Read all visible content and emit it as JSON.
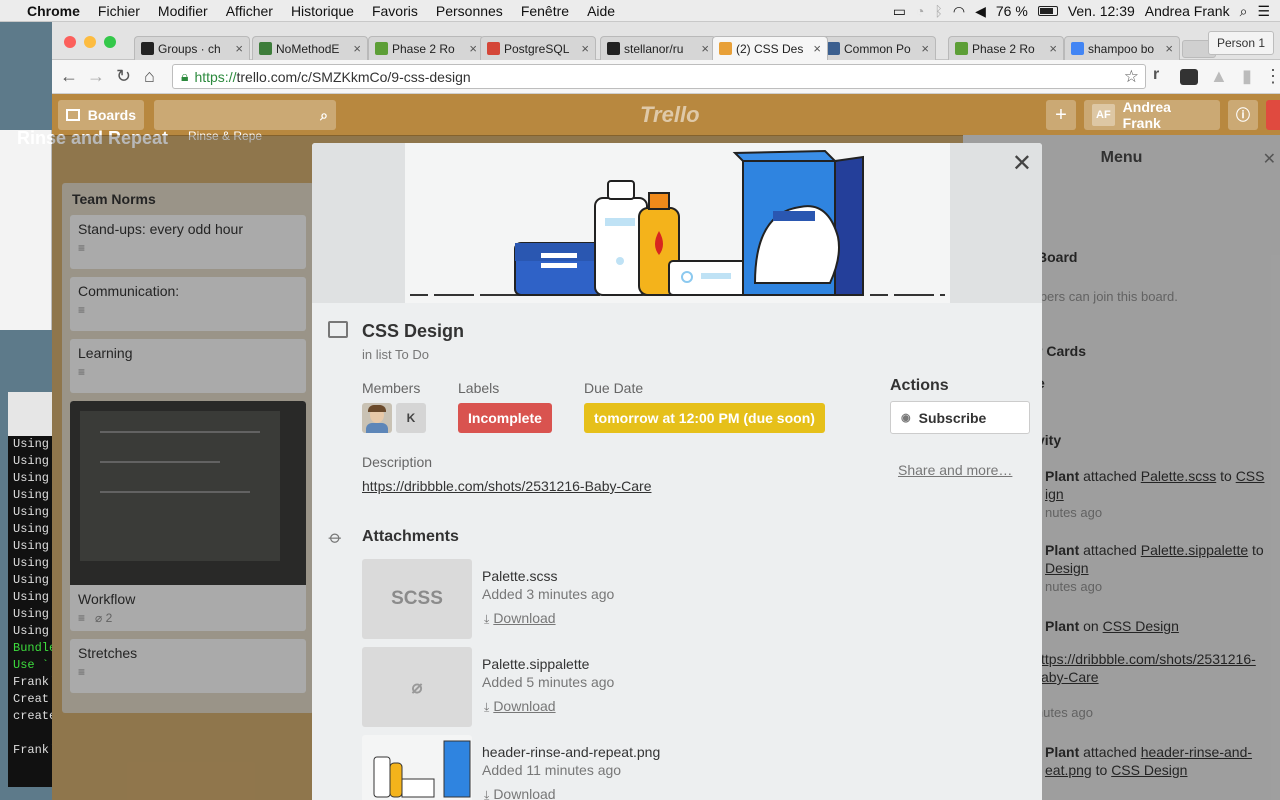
{
  "mac_menu": {
    "app": "Chrome",
    "items": [
      "Fichier",
      "Modifier",
      "Afficher",
      "Historique",
      "Favoris",
      "Personnes",
      "Fenêtre",
      "Aide"
    ],
    "battery": "76 %",
    "clock": "Ven. 12:39",
    "user": "Andrea Frank"
  },
  "browser": {
    "tabs": [
      {
        "title": "Groups · ch",
        "fav_color": "#222222"
      },
      {
        "title": "NoMethodE",
        "fav_color": "#3e7d3b"
      },
      {
        "title": "Phase 2 Ro",
        "fav_color": "#5c9e36"
      },
      {
        "title": "PostgreSQL",
        "fav_color": "#d44638"
      },
      {
        "title": "stellanor/ru",
        "fav_color": "#222222"
      },
      {
        "title": "(2) CSS Des",
        "fav_color": "#e8a038"
      },
      {
        "title": "Common Po",
        "fav_color": "#3b5f8f"
      },
      {
        "title": "Phase 2 Ro",
        "fav_color": "#5c9e36"
      },
      {
        "title": "shampoo bo",
        "fav_color": "#4285f4"
      }
    ],
    "active_tab": 5,
    "person": "Person 1",
    "url_scheme": "https://",
    "url_rest": "trello.com/c/SMZKkmCo/9-css-design"
  },
  "trello": {
    "boards_label": "Boards",
    "logo": "Trello",
    "avatar_initials": "AF",
    "user_name": "Andrea Frank",
    "board_title": "Rinse and Repeat",
    "board_sub": "Rinse & Repe",
    "list": {
      "title": "Team Norms",
      "cards": [
        {
          "title": "Stand-ups: every odd hour"
        },
        {
          "title": "Communication:"
        },
        {
          "title": "Learning"
        }
      ],
      "photo_card": {
        "title": "Workflow",
        "attachments": "2"
      },
      "last_card": {
        "title": "Stretches"
      }
    },
    "menu": {
      "title": "Menu",
      "board_item": "Board",
      "board_note": "mbers can join this board.",
      "cards_item": "r Cards",
      "e_item": "e",
      "activity": "vity",
      "act1_who": "Plant",
      "act1_pre": "attached",
      "act1_link": "Palette.scss",
      "act1_mid": "to",
      "act1_card": "CSS",
      "act1_card2": "ign",
      "act1_time": "nutes ago",
      "act2_who": "Plant",
      "act2_pre": "attached",
      "act2_link": "Palette.sippalette",
      "act2_mid": "to",
      "act2_card": "Design",
      "act2_time": "nutes ago",
      "act3_who": "Plant",
      "act3_mid": "on",
      "act3_card": "CSS Design",
      "act3_link": "ttps://dribbble.com/shots/2531216-",
      "act3_link2": "aby-Care",
      "act3_time": "inutes ago",
      "act4_who": "Plant",
      "act4_pre": "attached",
      "act4_link": "header-rinse-and-",
      "act4_link2": "eat.png",
      "act4_mid": "to",
      "act4_card": "CSS Design"
    }
  },
  "card": {
    "title": "CSS Design",
    "in_list": "in list To Do",
    "members_label": "Members",
    "member_initial": "K",
    "labels_label": "Labels",
    "label_text": "Incomplete",
    "label_color": "#d9534f",
    "due_label": "Due Date",
    "due_text": "tomorrow at 12:00 PM (due soon)",
    "due_color": "#e6c01a",
    "actions_label": "Actions",
    "subscribe": "Subscribe",
    "share": "Share and more…",
    "description_label": "Description",
    "description_link": "https://dribbble.com/shots/2531216-Baby-Care",
    "attachments_label": "Attachments",
    "attachments": [
      {
        "name": "Palette.scss",
        "added": "Added 3 minutes ago",
        "thumb": "SCSS",
        "download": "Download"
      },
      {
        "name": "Palette.sippalette",
        "added": "Added 5 minutes ago",
        "thumb": "",
        "download": "Download"
      },
      {
        "name": "header-rinse-and-repeat.png",
        "added": "Added 11 minutes ago",
        "thumb": "",
        "download": "Download"
      }
    ]
  },
  "terminal": {
    "lines": [
      "Using",
      "Using",
      "Using",
      "Using",
      "Using",
      "Using",
      "Using",
      "Using",
      "Using",
      "Using",
      "Using",
      "Using",
      "Bundle",
      "Use `",
      "Frank'",
      "Creat",
      "create",
      "",
      "Frank'"
    ]
  }
}
